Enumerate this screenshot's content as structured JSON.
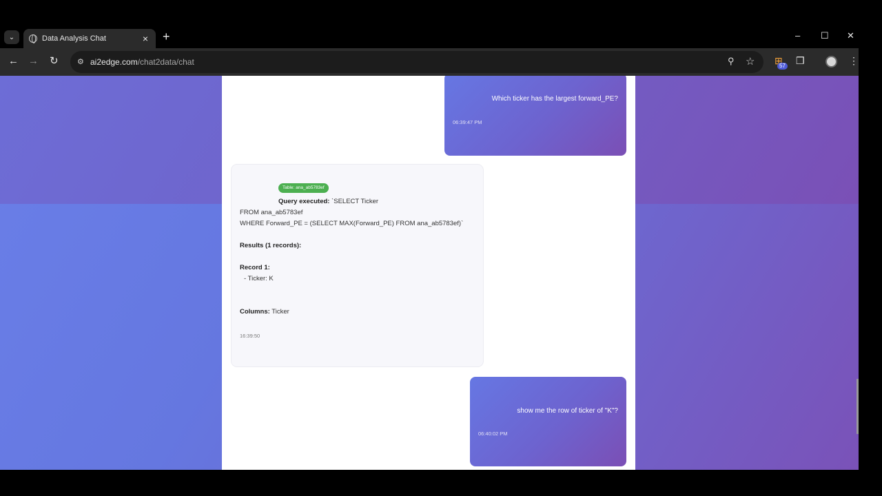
{
  "browser": {
    "tab_title": "Data Analysis Chat",
    "url_host": "ai2edge.com",
    "url_path": "/chat2data/chat",
    "extension_badge": "57"
  },
  "icons": {
    "tab_search": "chevron-down-icon",
    "tab_favicon": "globe-icon",
    "tab_close": "close-icon",
    "new_tab": "plus-icon",
    "minimize": "minimize-icon",
    "maximize": "maximize-icon",
    "close_window": "close-icon",
    "back": "back-arrow-icon",
    "forward": "forward-arrow-icon",
    "reload": "reload-icon",
    "site_settings": "site-settings-icon",
    "zoom": "zoom-icon",
    "bookmark": "star-icon",
    "rss": "rss-icon",
    "extensions": "puzzle-icon",
    "profile": "avatar-icon",
    "menu": "kebab-menu-icon"
  },
  "colors": {
    "user_bubble_start": "#6677e3",
    "user_bubble_end": "#7b4fb5",
    "table_badge": "#4caf50"
  },
  "chat": {
    "messages": [
      {
        "role": "user",
        "text": "Which ticker has the largest forward_PE?",
        "time": "06:39:47 PM"
      },
      {
        "role": "bot",
        "table_badge": "Table: ana_ab5783ef",
        "query_label": "Query executed:",
        "query_line1": " `SELECT Ticker",
        "query_line2": "FROM ana_ab5783ef",
        "query_line3": "WHERE Forward_PE = (SELECT MAX(Forward_PE) FROM ana_ab5783ef)`",
        "results_label": "Results (1 records):",
        "record_label": "Record 1:",
        "record_line": "- Ticker: K",
        "columns_label": "Columns:",
        "columns_value": " Ticker",
        "time": "16:39:50"
      },
      {
        "role": "user",
        "text": "show me the row of ticker of \"K\"?",
        "time": "06:40:02 PM"
      }
    ]
  }
}
